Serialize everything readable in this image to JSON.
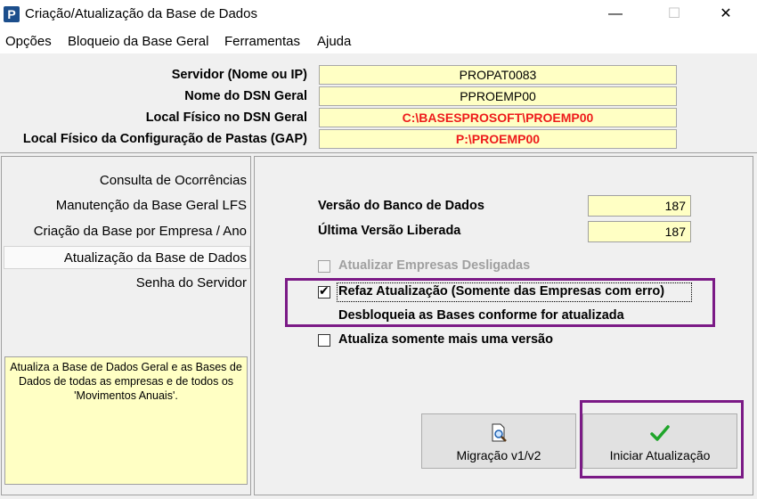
{
  "window": {
    "title": "Criação/Atualização da Base de Dados",
    "app_icon": "P",
    "minimize": "—",
    "maximize": "☐",
    "close": "✕"
  },
  "menu": [
    "Opções",
    "Bloqueio da Base Geral",
    "Ferramentas",
    "Ajuda"
  ],
  "header": {
    "servidor_label": "Servidor (Nome ou IP)",
    "servidor_value": "PROPAT0083",
    "dsn_label": "Nome do DSN Geral",
    "dsn_value": "PPROEMP00",
    "local_dsn_label": "Local Físico no DSN Geral",
    "local_dsn_value": "C:\\BASESPROSOFT\\PROEMP00",
    "local_gap_label": "Local Físico da Configuração de Pastas (GAP)",
    "local_gap_value": "P:\\PROEMP00"
  },
  "sidebar": {
    "items": [
      "Consulta de Ocorrências",
      "Manutenção da Base Geral LFS",
      "Criação da Base por Empresa / Ano",
      "Atualização da Base de Dados",
      "Senha do Servidor"
    ],
    "active_index": 3,
    "description": "Atualiza a Base de Dados Geral e as Bases de Dados de todas as empresas e de todos os 'Movimentos Anuais'."
  },
  "versions": {
    "db_version_label": "Versão do Banco de Dados",
    "db_version_value": "187",
    "released_label": "Última Versão Liberada",
    "released_value": "187"
  },
  "options": {
    "disconnected_label": "Atualizar Empresas Desligadas",
    "disconnected_checked": false,
    "disconnected_enabled": false,
    "redo_label": "Refaz Atualização (Somente das Empresas com erro)",
    "redo_checked": true,
    "unlock_note": "Desbloqueia as Bases conforme for atualizada",
    "one_more_label": "Atualiza somente mais uma versão",
    "one_more_checked": false
  },
  "buttons": {
    "migration_label": "Migração v1/v2",
    "migration_icon": "magnifier-page-icon",
    "start_label": "Iniciar Atualização",
    "start_icon": "checkmark-icon"
  },
  "colors": {
    "field_background": "#ffffc4",
    "red_text": "#ee1b1b",
    "highlight_border": "#7b1a86",
    "check_green": "#1fa52a"
  }
}
